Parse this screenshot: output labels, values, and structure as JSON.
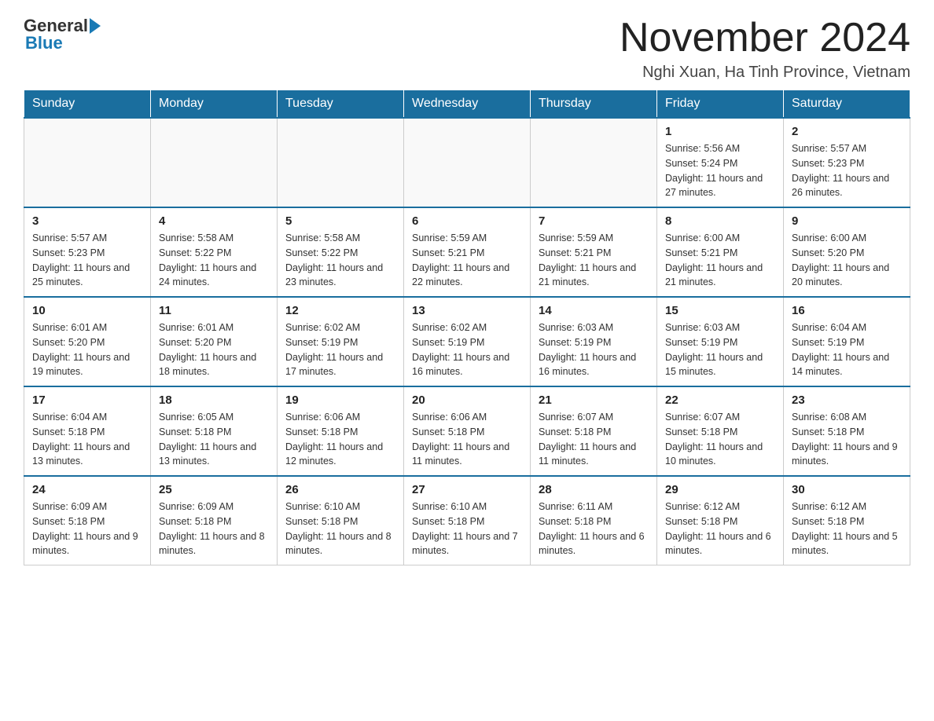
{
  "header": {
    "logo_general": "General",
    "logo_blue": "Blue",
    "month_title": "November 2024",
    "location": "Nghi Xuan, Ha Tinh Province, Vietnam"
  },
  "weekdays": [
    "Sunday",
    "Monday",
    "Tuesday",
    "Wednesday",
    "Thursday",
    "Friday",
    "Saturday"
  ],
  "weeks": [
    [
      {
        "day": "",
        "info": ""
      },
      {
        "day": "",
        "info": ""
      },
      {
        "day": "",
        "info": ""
      },
      {
        "day": "",
        "info": ""
      },
      {
        "day": "",
        "info": ""
      },
      {
        "day": "1",
        "info": "Sunrise: 5:56 AM\nSunset: 5:24 PM\nDaylight: 11 hours and 27 minutes."
      },
      {
        "day": "2",
        "info": "Sunrise: 5:57 AM\nSunset: 5:23 PM\nDaylight: 11 hours and 26 minutes."
      }
    ],
    [
      {
        "day": "3",
        "info": "Sunrise: 5:57 AM\nSunset: 5:23 PM\nDaylight: 11 hours and 25 minutes."
      },
      {
        "day": "4",
        "info": "Sunrise: 5:58 AM\nSunset: 5:22 PM\nDaylight: 11 hours and 24 minutes."
      },
      {
        "day": "5",
        "info": "Sunrise: 5:58 AM\nSunset: 5:22 PM\nDaylight: 11 hours and 23 minutes."
      },
      {
        "day": "6",
        "info": "Sunrise: 5:59 AM\nSunset: 5:21 PM\nDaylight: 11 hours and 22 minutes."
      },
      {
        "day": "7",
        "info": "Sunrise: 5:59 AM\nSunset: 5:21 PM\nDaylight: 11 hours and 21 minutes."
      },
      {
        "day": "8",
        "info": "Sunrise: 6:00 AM\nSunset: 5:21 PM\nDaylight: 11 hours and 21 minutes."
      },
      {
        "day": "9",
        "info": "Sunrise: 6:00 AM\nSunset: 5:20 PM\nDaylight: 11 hours and 20 minutes."
      }
    ],
    [
      {
        "day": "10",
        "info": "Sunrise: 6:01 AM\nSunset: 5:20 PM\nDaylight: 11 hours and 19 minutes."
      },
      {
        "day": "11",
        "info": "Sunrise: 6:01 AM\nSunset: 5:20 PM\nDaylight: 11 hours and 18 minutes."
      },
      {
        "day": "12",
        "info": "Sunrise: 6:02 AM\nSunset: 5:19 PM\nDaylight: 11 hours and 17 minutes."
      },
      {
        "day": "13",
        "info": "Sunrise: 6:02 AM\nSunset: 5:19 PM\nDaylight: 11 hours and 16 minutes."
      },
      {
        "day": "14",
        "info": "Sunrise: 6:03 AM\nSunset: 5:19 PM\nDaylight: 11 hours and 16 minutes."
      },
      {
        "day": "15",
        "info": "Sunrise: 6:03 AM\nSunset: 5:19 PM\nDaylight: 11 hours and 15 minutes."
      },
      {
        "day": "16",
        "info": "Sunrise: 6:04 AM\nSunset: 5:19 PM\nDaylight: 11 hours and 14 minutes."
      }
    ],
    [
      {
        "day": "17",
        "info": "Sunrise: 6:04 AM\nSunset: 5:18 PM\nDaylight: 11 hours and 13 minutes."
      },
      {
        "day": "18",
        "info": "Sunrise: 6:05 AM\nSunset: 5:18 PM\nDaylight: 11 hours and 13 minutes."
      },
      {
        "day": "19",
        "info": "Sunrise: 6:06 AM\nSunset: 5:18 PM\nDaylight: 11 hours and 12 minutes."
      },
      {
        "day": "20",
        "info": "Sunrise: 6:06 AM\nSunset: 5:18 PM\nDaylight: 11 hours and 11 minutes."
      },
      {
        "day": "21",
        "info": "Sunrise: 6:07 AM\nSunset: 5:18 PM\nDaylight: 11 hours and 11 minutes."
      },
      {
        "day": "22",
        "info": "Sunrise: 6:07 AM\nSunset: 5:18 PM\nDaylight: 11 hours and 10 minutes."
      },
      {
        "day": "23",
        "info": "Sunrise: 6:08 AM\nSunset: 5:18 PM\nDaylight: 11 hours and 9 minutes."
      }
    ],
    [
      {
        "day": "24",
        "info": "Sunrise: 6:09 AM\nSunset: 5:18 PM\nDaylight: 11 hours and 9 minutes."
      },
      {
        "day": "25",
        "info": "Sunrise: 6:09 AM\nSunset: 5:18 PM\nDaylight: 11 hours and 8 minutes."
      },
      {
        "day": "26",
        "info": "Sunrise: 6:10 AM\nSunset: 5:18 PM\nDaylight: 11 hours and 8 minutes."
      },
      {
        "day": "27",
        "info": "Sunrise: 6:10 AM\nSunset: 5:18 PM\nDaylight: 11 hours and 7 minutes."
      },
      {
        "day": "28",
        "info": "Sunrise: 6:11 AM\nSunset: 5:18 PM\nDaylight: 11 hours and 6 minutes."
      },
      {
        "day": "29",
        "info": "Sunrise: 6:12 AM\nSunset: 5:18 PM\nDaylight: 11 hours and 6 minutes."
      },
      {
        "day": "30",
        "info": "Sunrise: 6:12 AM\nSunset: 5:18 PM\nDaylight: 11 hours and 5 minutes."
      }
    ]
  ]
}
